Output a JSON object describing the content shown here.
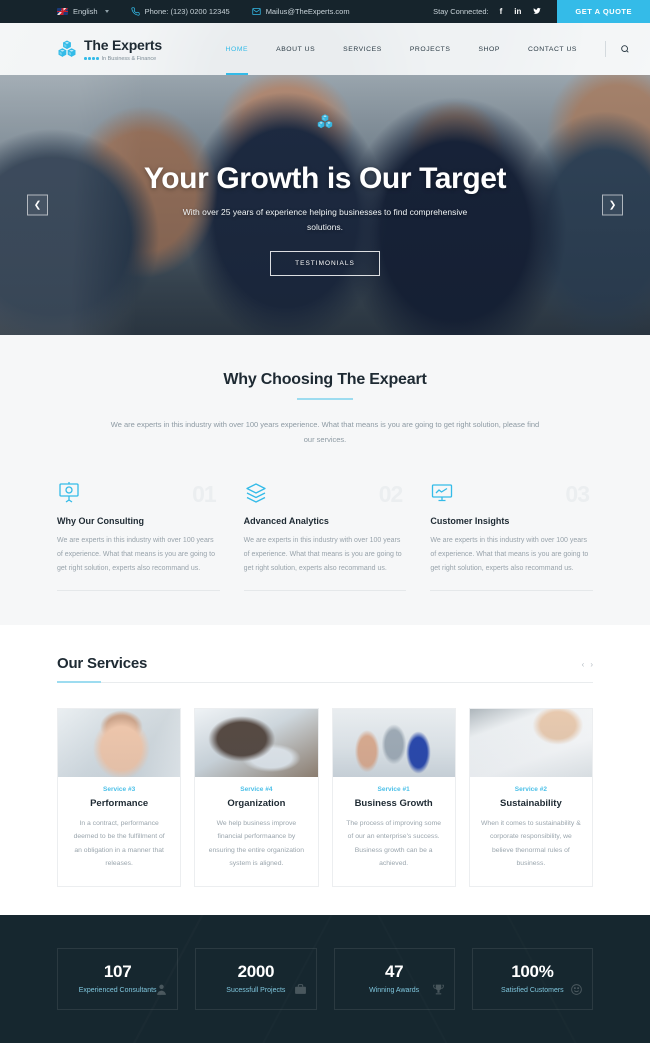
{
  "topbar": {
    "language": "English",
    "language_icon": "uk-flag-icon",
    "phone_icon": "phone-icon",
    "phone": "Phone: (123) 0200 12345",
    "email_icon": "mail-icon",
    "email": "Mailus@TheExperts.com",
    "stay_connected": "Stay Connected:",
    "social": [
      {
        "name": "facebook-icon",
        "glyph": "f"
      },
      {
        "name": "linkedin-icon",
        "glyph": "in"
      },
      {
        "name": "twitter-icon",
        "glyph": "t"
      }
    ],
    "quote_label": "GET A QUOTE",
    "accent": "#34bbe8",
    "background": "#16242c"
  },
  "header": {
    "logo_icon": "cubes-logo-icon",
    "brand": "The Experts",
    "tagline": "In Business & Finance",
    "nav": [
      {
        "label": "HOME",
        "active": true
      },
      {
        "label": "ABOUT US",
        "active": false
      },
      {
        "label": "SERVICES",
        "active": false
      },
      {
        "label": "PROJECTS",
        "active": false
      },
      {
        "label": "SHOP",
        "active": false
      },
      {
        "label": "CONTACT US",
        "active": false
      }
    ],
    "search_icon": "search-icon"
  },
  "hero": {
    "title": "Your Growth is Our Target",
    "subtitle": "With over 25 years of experience helping businesses to find comprehensive solutions.",
    "button": "TESTIMONIALS",
    "prev_icon": "chevron-left-icon",
    "next_icon": "chevron-right-icon",
    "prev_glyph": "❮",
    "next_glyph": "❯"
  },
  "why": {
    "title": "Why Choosing The Expeart",
    "description": "We are experts in this industry with over 100 years experience. What that means is you are going to get right solution, please find our services.",
    "features": [
      {
        "number": "01",
        "icon": "presentation-board-icon",
        "title": "Why Our Consulting",
        "text": "We are experts in this industry with over 100 years of experience. What that means is you are going to get right solution, experts also recommand us."
      },
      {
        "number": "02",
        "icon": "layers-stack-icon",
        "title": "Advanced Analytics",
        "text": "We are experts in this industry with over 100 years of experience. What that means is you are going to get right solution, experts also recommand us."
      },
      {
        "number": "03",
        "icon": "monitor-chart-icon",
        "title": "Customer Insights",
        "text": "We are experts in this industry with over 100 years of experience. What that means is you are going to get right solution, experts also recommand us."
      }
    ]
  },
  "services": {
    "title": "Our Services",
    "prev_glyph": "‹",
    "next_glyph": "›",
    "cards": [
      {
        "tag": "Service #3",
        "title": "Performance",
        "text": "In a contract, performance deemed to be the fulfillment of an obligation in a manner that releases.",
        "image": "woman-glasses-photo"
      },
      {
        "tag": "Service #4",
        "title": "Organization",
        "text": "We help business improve financial performaance by ensuring the entire organization system is aligned.",
        "image": "hands-laptop-photo"
      },
      {
        "tag": "Service #1",
        "title": "Business Growth",
        "text": "The process of improving some of our an enterprise's success. Business growth can be a achieved.",
        "image": "team-meeting-photo"
      },
      {
        "tag": "Service #2",
        "title": "Sustainability",
        "text": "When it comes to sustainability & corporate responsibility, we believe thenormal rules of business.",
        "image": "hand-writing-notebook-photo"
      }
    ]
  },
  "stats": {
    "background": "#16272f",
    "label_color": "#7fc6dd",
    "items": [
      {
        "value": "107",
        "label": "Experienced Consultants",
        "icon": "person-icon"
      },
      {
        "value": "2000",
        "label": "Sucessfull Projects",
        "icon": "briefcase-icon"
      },
      {
        "value": "47",
        "label": "Winning Awards",
        "icon": "trophy-icon"
      },
      {
        "value": "100%",
        "label": "Satisfied Customers",
        "icon": "smiley-icon"
      }
    ]
  }
}
